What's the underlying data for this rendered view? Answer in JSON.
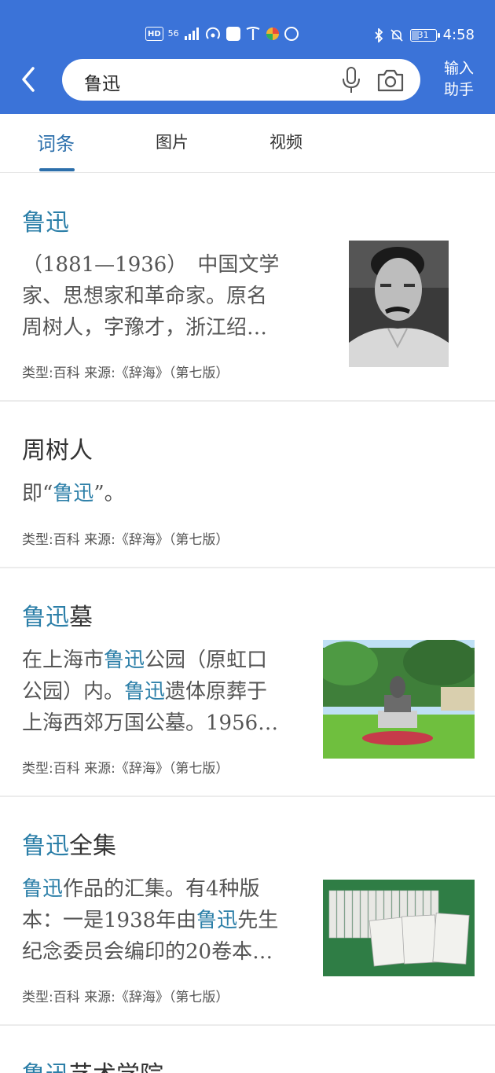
{
  "status_bar": {
    "left_labels": [
      "HD",
      "56"
    ],
    "time": "4:58",
    "battery": "31"
  },
  "search": {
    "query": "鲁迅",
    "assistant_label_line1": "输入",
    "assistant_label_line2": "助手"
  },
  "tabs": [
    {
      "label": "词条"
    },
    {
      "label": "图片"
    },
    {
      "label": "视频"
    }
  ],
  "entries": [
    {
      "title_hl": "鲁迅",
      "title_rest": "",
      "desc_line1": "（1881—1936）　中国文学",
      "desc_line2": "家、思想家和革命家。原名",
      "desc_line3": "周树人，字豫才，浙江绍…",
      "meta": "类型:百科  来源:《辞海》（第七版）"
    },
    {
      "title_hl": "",
      "title_rest": "周树人",
      "desc_pre": "即“",
      "desc_hl": "鲁迅",
      "desc_post": "”。",
      "meta": "类型:百科  来源:《辞海》（第七版）"
    },
    {
      "title_hl": "鲁迅",
      "title_rest": "墓",
      "desc_a1": "在上海市",
      "desc_a2": "鲁迅",
      "desc_a3": "公园（原虹口",
      "desc_b1": "公园）内。",
      "desc_b2": "鲁迅",
      "desc_b3": "遗体原葬于",
      "desc_c": "上海西郊万国公墓。1956…",
      "meta": "类型:百科  来源:《辞海》（第七版）"
    },
    {
      "title_hl": "鲁迅",
      "title_rest": "全集",
      "desc_a1": "鲁迅",
      "desc_a2": "作品的汇集。有4种版",
      "desc_b1": "本：一是1938年由",
      "desc_b2": "鲁迅",
      "desc_b3": "先生",
      "desc_c": "纪念委员会编印的20卷本…",
      "meta": "类型:百科  来源:《辞海》（第七版）"
    },
    {
      "title_hl": "鲁迅",
      "title_rest": "艺术学院"
    }
  ],
  "colors": {
    "header_blue": "#3b73d8",
    "link_blue": "#2c7fa8",
    "tab_active": "#2c6fab"
  }
}
